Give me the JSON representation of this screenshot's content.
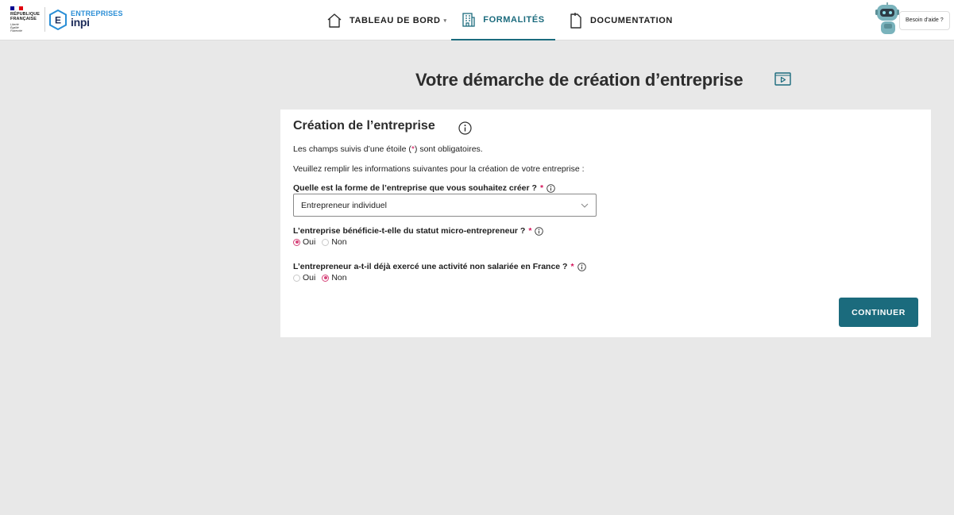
{
  "header": {
    "rf_logo": {
      "line1": "RÉPUBLIQUE",
      "line2": "FRANÇAISE",
      "motto": [
        "Liberté",
        "Égalité",
        "Fraternité"
      ],
      "flag_colors": [
        "#000091",
        "#ffffff",
        "#e1000f"
      ]
    },
    "brand": {
      "top": "ENTREPRISES",
      "bottom": "inpi",
      "e_letter": "E"
    },
    "nav": {
      "dashboard": {
        "label": "TABLEAU DE BORD",
        "icon": "home-icon",
        "caret": "▾"
      },
      "formalites": {
        "label": "FORMALITÉS",
        "icon": "building-icon",
        "active": true
      },
      "documentation": {
        "label": "DOCUMENTATION",
        "icon": "document-icon"
      }
    },
    "help": {
      "label": "Besoin d'aide ?",
      "icon": "robot-icon"
    }
  },
  "page": {
    "title": "Votre démarche de création d’entreprise",
    "title_icon": "video-icon"
  },
  "form": {
    "title": "Création de l’entreprise",
    "title_icon": "info-icon",
    "required_note": {
      "before": "Les champs suivis d’une étoile (",
      "star": "*",
      "after": ") sont obligatoires."
    },
    "instructions": "Veuillez remplir les informations suivantes pour la création de votre entreprise :",
    "q1": {
      "label": "Quelle est la forme de l’entreprise que vous souhaitez créer ?",
      "star": "*",
      "value": "Entrepreneur individuel"
    },
    "q2": {
      "label": "L’entreprise bénéficie-t-elle du statut micro-entrepreneur ?",
      "star": "*",
      "options": [
        "Oui",
        "Non"
      ],
      "selected": "Oui"
    },
    "q3": {
      "label": "L’entrepreneur a-t-il déjà exercé une activité non salariée en France ?",
      "star": "*",
      "options": [
        "Oui",
        "Non"
      ],
      "selected": "Non"
    },
    "continue_label": "CONTINUER"
  },
  "colors": {
    "accent": "#1b6b7d",
    "radio_selected": "#d6457a",
    "required": "#d4145a",
    "background": "#e8e8e8"
  }
}
